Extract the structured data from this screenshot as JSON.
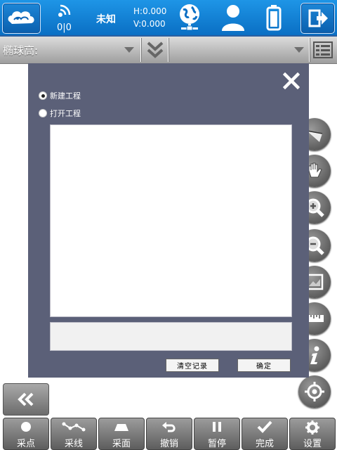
{
  "status": {
    "satellites": "0|0",
    "fix_status": "未知",
    "h_precision": "H:0.000",
    "v_precision": "V:0.000"
  },
  "height_bar": {
    "label": "椭球高:"
  },
  "dialog": {
    "option_new": "新建工程",
    "option_open": "打开工程",
    "selected_option": "new",
    "path_value": "",
    "clear_button": "清空记录",
    "ok_button": "确定"
  },
  "tools": [
    "compass-icon",
    "hand-icon",
    "zoom-in-icon",
    "zoom-out-icon",
    "full-extent-icon",
    "ruler-icon",
    "info-icon",
    "locate-icon"
  ],
  "bottom": {
    "point": "采点",
    "line": "采线",
    "area": "采面",
    "undo": "撤销",
    "pause": "暂停",
    "finish": "完成",
    "settings": "设置"
  },
  "colors": {
    "topbar": "#0a7fd6",
    "dialog_bg": "#5b6078",
    "toolbar_gray": "#7a7a7a"
  }
}
